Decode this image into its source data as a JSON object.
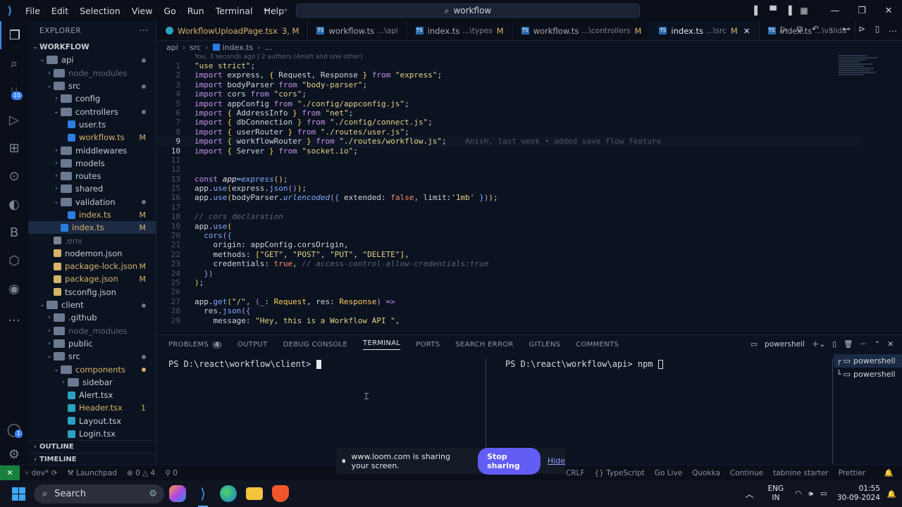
{
  "titlebar": {
    "menu": [
      "File",
      "Edit",
      "Selection",
      "View",
      "Go",
      "Run",
      "Terminal",
      "Help"
    ],
    "search": "workflow"
  },
  "explorer": {
    "header": "EXPLORER",
    "root": "WORKFLOW",
    "items": [
      {
        "label": "api",
        "depth": 1,
        "open": true,
        "type": "folder",
        "status": "dot"
      },
      {
        "label": "node_modules",
        "depth": 2,
        "open": false,
        "type": "folder",
        "dim": true
      },
      {
        "label": "src",
        "depth": 2,
        "open": true,
        "type": "folder",
        "status": "dot"
      },
      {
        "label": "config",
        "depth": 3,
        "open": false,
        "type": "folder"
      },
      {
        "label": "controllers",
        "depth": 3,
        "open": true,
        "type": "folder",
        "status": "dot"
      },
      {
        "label": "user.ts",
        "depth": 4,
        "type": "ts"
      },
      {
        "label": "workflow.ts",
        "depth": 4,
        "type": "ts",
        "status": "M"
      },
      {
        "label": "middlewares",
        "depth": 3,
        "open": false,
        "type": "folder"
      },
      {
        "label": "models",
        "depth": 3,
        "open": false,
        "type": "folder"
      },
      {
        "label": "routes",
        "depth": 3,
        "open": false,
        "type": "folder"
      },
      {
        "label": "shared",
        "depth": 3,
        "open": false,
        "type": "folder"
      },
      {
        "label": "validation",
        "depth": 3,
        "open": true,
        "type": "folder",
        "status": "dot"
      },
      {
        "label": "index.ts",
        "depth": 4,
        "type": "ts",
        "status": "M"
      },
      {
        "label": "index.ts",
        "depth": 3,
        "type": "ts",
        "status": "M",
        "selected": true
      },
      {
        "label": ".env",
        "depth": 2,
        "type": "env",
        "dim": true
      },
      {
        "label": "nodemon.json",
        "depth": 2,
        "type": "json"
      },
      {
        "label": "package-lock.json",
        "depth": 2,
        "type": "json",
        "status": "M"
      },
      {
        "label": "package.json",
        "depth": 2,
        "type": "json",
        "status": "M"
      },
      {
        "label": "tsconfig.json",
        "depth": 2,
        "type": "json"
      },
      {
        "label": "client",
        "depth": 1,
        "open": true,
        "type": "folder",
        "status": "dot"
      },
      {
        "label": ".github",
        "depth": 2,
        "open": false,
        "type": "folder"
      },
      {
        "label": "node_modules",
        "depth": 2,
        "open": false,
        "type": "folder",
        "dim": true
      },
      {
        "label": "public",
        "depth": 2,
        "open": false,
        "type": "folder"
      },
      {
        "label": "src",
        "depth": 2,
        "open": true,
        "type": "folder",
        "status": "dot"
      },
      {
        "label": "components",
        "depth": 3,
        "open": true,
        "type": "folder",
        "status": "dot",
        "amber": true
      },
      {
        "label": "sidebar",
        "depth": 4,
        "open": false,
        "type": "folder"
      },
      {
        "label": "Alert.tsx",
        "depth": 4,
        "type": "tsx"
      },
      {
        "label": "Header.tsx",
        "depth": 4,
        "type": "tsx",
        "status": "1",
        "amber": true
      },
      {
        "label": "Layout.tsx",
        "depth": 4,
        "type": "tsx"
      },
      {
        "label": "Login.tsx",
        "depth": 4,
        "type": "tsx"
      }
    ],
    "outline": "OUTLINE",
    "timeline": "TIMELINE"
  },
  "tabs": [
    {
      "icon": "react",
      "name": "WorkflowUploadPage.tsx",
      "extra": "3, M",
      "mod": true
    },
    {
      "icon": "ts",
      "name": "workflow.ts",
      "sub": "...\\api"
    },
    {
      "icon": "ts",
      "name": "index.ts",
      "sub": "...\\types",
      "extra": "M"
    },
    {
      "icon": "ts",
      "name": "workflow.ts",
      "sub": "...\\controllers",
      "extra": "M"
    },
    {
      "icon": "ts",
      "name": "index.ts",
      "sub": "...\\src",
      "extra": "M",
      "active": true
    },
    {
      "icon": "ts",
      "name": "index.ts",
      "sub": "...\\valida"
    }
  ],
  "breadcrumb": [
    "api",
    "src",
    "index.ts",
    "..."
  ],
  "blame": "You, 3 seconds ago | 2 authors (Anish and one other)",
  "line_blame": "Anish, last week • added save flow feature",
  "panel": {
    "tabs": [
      "PROBLEMS",
      "OUTPUT",
      "DEBUG CONSOLE",
      "TERMINAL",
      "PORTS",
      "SEARCH ERROR",
      "GITLENS",
      "COMMENTS"
    ],
    "problems_count": "4",
    "active_tab": "TERMINAL",
    "shell_label": "powershell",
    "term_left": "PS D:\\react\\workflow\\client> ",
    "term_right": "PS D:\\react\\workflow\\api> npm ",
    "term_list": [
      "powershell",
      "powershell"
    ]
  },
  "loom": {
    "text": "www.loom.com is sharing your screen.",
    "stop": "Stop sharing",
    "hide": "Hide"
  },
  "statusbar": {
    "branch": "dev*",
    "launchpad": "Launchpad",
    "errors": "0",
    "warnings": "4",
    "ports": "0",
    "right": [
      "CRLF",
      "{} TypeScript",
      "Go Live",
      "Quokka",
      "Continue",
      "tabnine starter",
      "Prettier"
    ]
  },
  "taskbar": {
    "search": "Search",
    "lang1": "ENG",
    "lang2": "IN",
    "time": "01:55",
    "date": "30-09-2024"
  }
}
